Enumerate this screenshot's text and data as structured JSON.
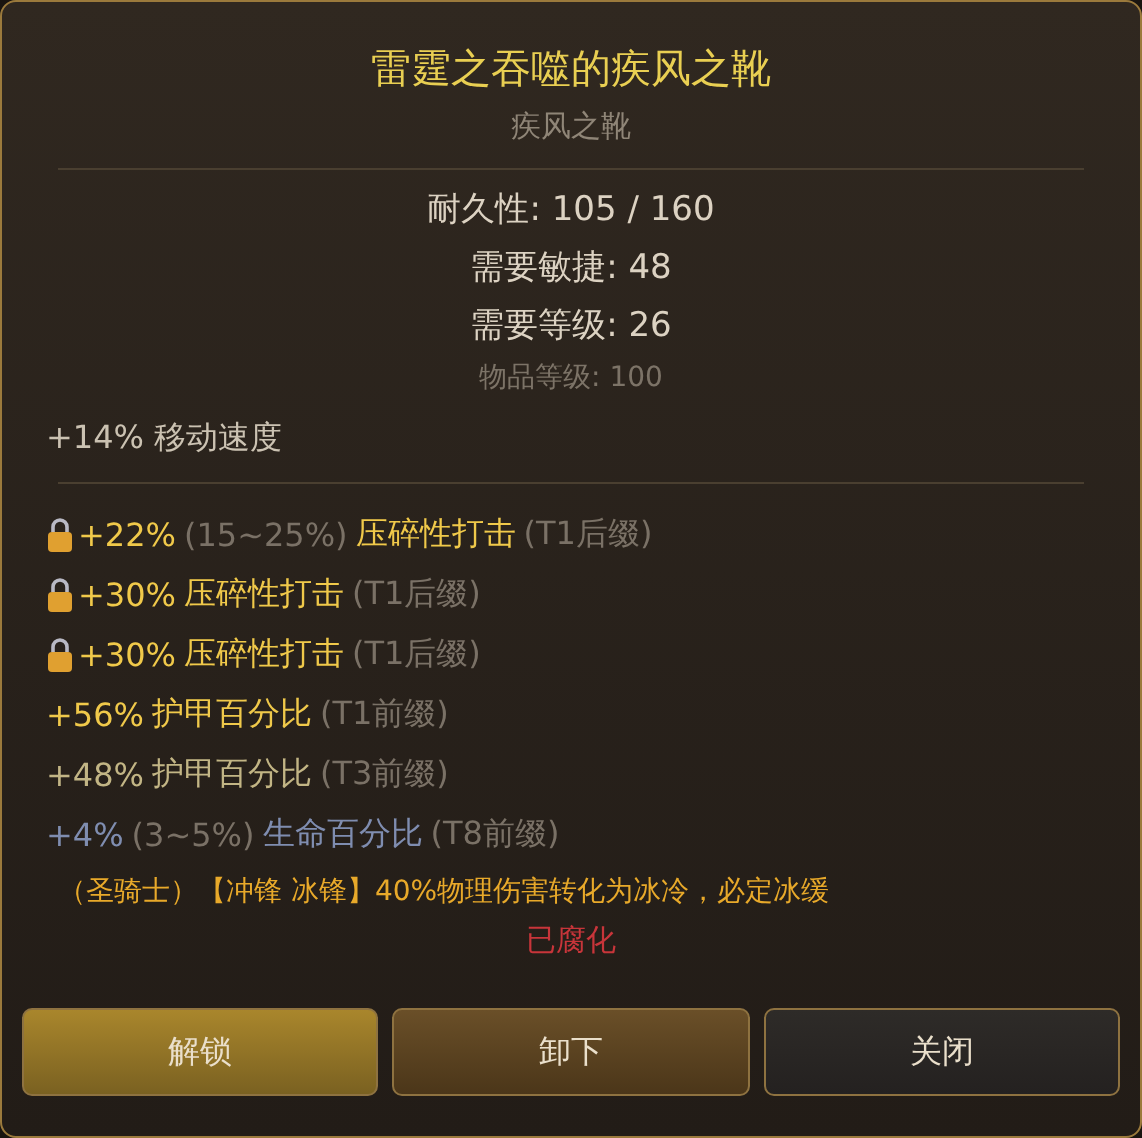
{
  "item": {
    "name": "雷霆之吞噬的疾风之靴",
    "base": "疾风之靴"
  },
  "stats": [
    {
      "text": "耐久性: 105 / 160",
      "kind": "main"
    },
    {
      "text": "需要敏捷: 48",
      "kind": "main"
    },
    {
      "text": "需要等级: 26",
      "kind": "main"
    },
    {
      "text": "物品等级: 100",
      "kind": "dim"
    }
  ],
  "implicit": "+14% 移动速度",
  "affixes": [
    {
      "locked": true,
      "value": "+22%",
      "range": "(15~25%)",
      "name": "压碎性打击",
      "tier": "(T1后缀)",
      "color": "#f0c94a"
    },
    {
      "locked": true,
      "value": "+30%",
      "name": "压碎性打击",
      "tier": "(T1后缀)",
      "color": "#f0c94a"
    },
    {
      "locked": true,
      "value": "+30%",
      "name": "压碎性打击",
      "tier": "(T1后缀)",
      "color": "#f0c94a"
    },
    {
      "locked": false,
      "value": "+56%",
      "name": "护甲百分比",
      "tier": "(T1前缀)",
      "color": "#f0c94a"
    },
    {
      "locked": false,
      "value": "+48%",
      "name": "护甲百分比",
      "tier": "(T3前缀)",
      "color": "#c2b585"
    },
    {
      "locked": false,
      "value": "+4%",
      "range": "(3~5%)",
      "name": "生命百分比",
      "tier": "(T8前缀)",
      "color": "#7f8db0"
    }
  ],
  "special": "（圣骑士）【冲锋 冰锋】40%物理伤害转化为冰冷，必定冰缓",
  "corrupted": "已腐化",
  "buttons": [
    {
      "label": "解锁",
      "kind": "gold"
    },
    {
      "label": "卸下",
      "kind": "brown"
    },
    {
      "label": "关闭",
      "kind": "dark"
    }
  ]
}
